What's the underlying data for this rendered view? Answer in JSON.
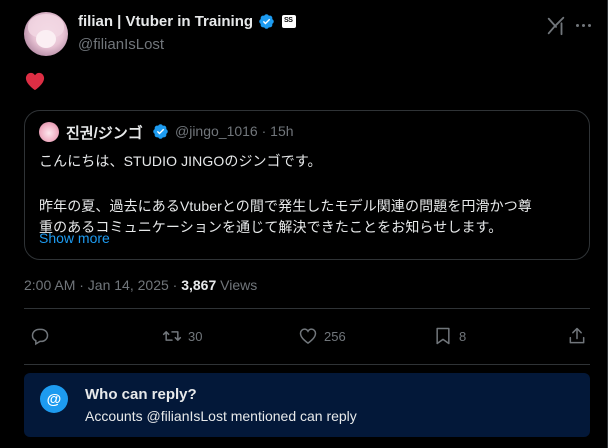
{
  "author": {
    "display_name": "filian | Vtuber in Training",
    "handle": "@filianIsLost"
  },
  "post": {
    "emoji": "heart"
  },
  "quoted": {
    "display_name": "진권/ジンゴ",
    "meta": "@jingo_1016 · 15h",
    "line1": "こんにちは、STUDIO JINGOのジンゴです。",
    "line2": "昨年の夏、過去にあるVtuberとの間で発生したモデル関連の問題を円滑かつ尊",
    "line3": "重のあるコミュニケーションを通じて解決できたことをお知らせします。",
    "show_more": "Show more"
  },
  "meta": {
    "timestamp": "2:00 AM · Jan 14, 2025 · ",
    "views_count": "3,867",
    "views_label": " Views"
  },
  "actions": {
    "reply_count": "",
    "retweet_count": "30",
    "like_count": "256",
    "bookmark_count": "8"
  },
  "who_can_reply": {
    "icon_text": "@",
    "title": "Who can reply?",
    "subtitle": "Accounts @filianIsLost mentioned can reply"
  },
  "colors": {
    "background": "#000000",
    "accent": "#1d9bf0",
    "muted": "#71767b",
    "border": "#2f3336",
    "heart": "#f91880",
    "reply_banner": "#031839"
  }
}
